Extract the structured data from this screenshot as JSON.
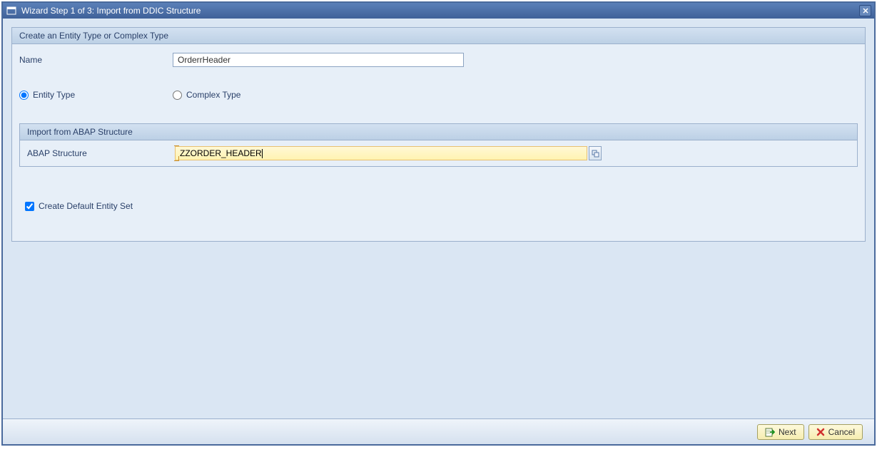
{
  "window": {
    "title": "Wizard Step 1 of 3: Import from DDIC Structure"
  },
  "group1": {
    "header": "Create an Entity Type or Complex Type",
    "name_label": "Name",
    "name_value": "OrderrHeader",
    "entity_type_label": "Entity Type",
    "complex_type_label": "Complex Type"
  },
  "group2": {
    "header": "Import from ABAP Structure",
    "abap_label": "ABAP Structure",
    "abap_value": "ZZORDER_HEADER"
  },
  "checkbox": {
    "label": "Create Default Entity Set"
  },
  "buttons": {
    "next": "Next",
    "cancel": "Cancel"
  }
}
